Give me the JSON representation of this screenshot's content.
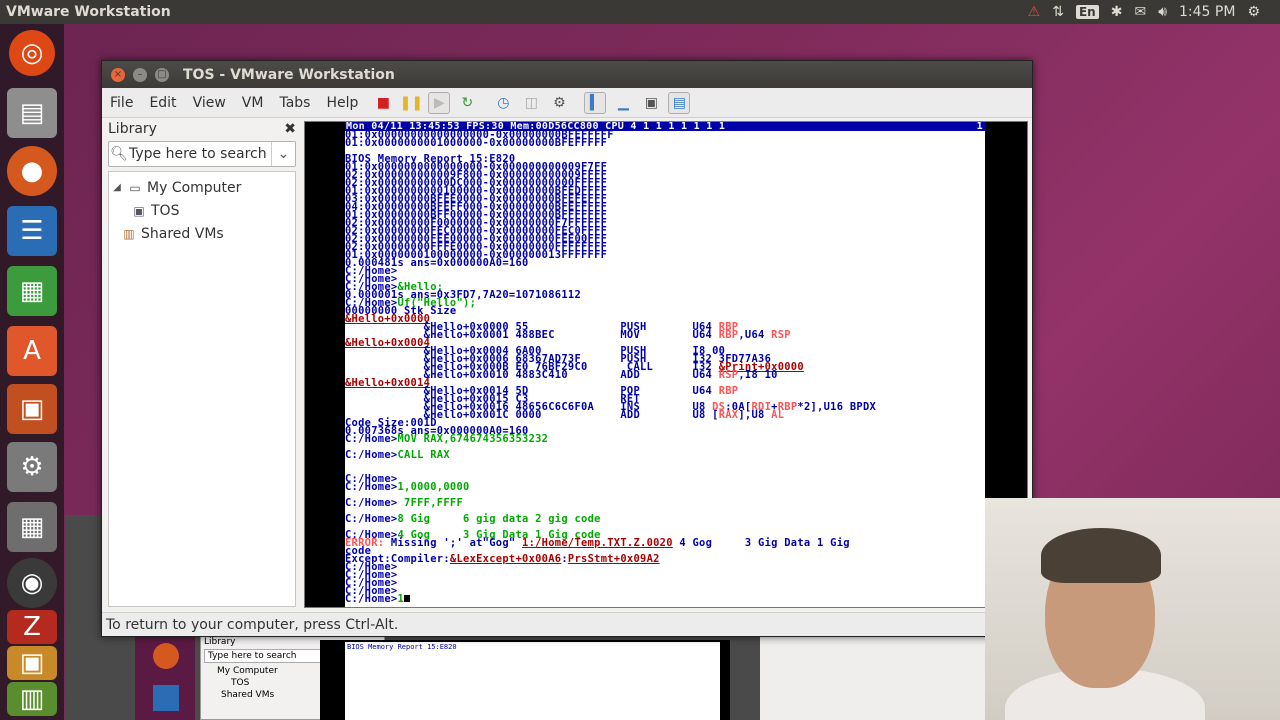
{
  "top_panel": {
    "app_title": "VMware Workstation",
    "language": "En",
    "clock": "1:45 PM"
  },
  "window": {
    "title": "TOS - VMware Workstation",
    "menus": [
      "File",
      "Edit",
      "View",
      "VM",
      "Tabs",
      "Help"
    ]
  },
  "library": {
    "title": "Library",
    "search_placeholder": "Type here to search",
    "tree": {
      "my_computer": "My Computer",
      "tos": "TOS",
      "shared_vms": "Shared VMs"
    }
  },
  "status_bar": {
    "message": "To return to your computer, press Ctrl-Alt."
  },
  "vm_screen": {
    "status_line": "Mon 04/11 13:45:53 FPS:30 Mem:00D56CC800 CPU 4 1 1 1 1 1 1 1",
    "status_tail": "1",
    "lines": [
      [
        {
          "t": "01:0x00000000000000000-0x00000000BFEFFFFF",
          "c": "b"
        }
      ],
      [
        {
          "t": "01:0x0000000001000000-0x00000000BFEFFFFF",
          "c": "b"
        }
      ],
      [
        {
          "t": "",
          "c": "b"
        }
      ],
      [
        {
          "t": "BIOS Memory Report 15:E820",
          "c": "b"
        }
      ],
      [
        {
          "t": "01:0x0000000000000000-0x000000000009F7FF",
          "c": "b"
        }
      ],
      [
        {
          "t": "02:0x000000000009F800-0x000000000009FFFF",
          "c": "b"
        }
      ],
      [
        {
          "t": "02:0x00000000000DC000-0x00000000000FFFFF",
          "c": "b"
        }
      ],
      [
        {
          "t": "01:0x0000000000100000-0x00000000BFEDFFFF",
          "c": "b"
        }
      ],
      [
        {
          "t": "03:0x00000000BFEE0000-0x00000000BFEFEFFF",
          "c": "b"
        }
      ],
      [
        {
          "t": "04:0x00000000BFEFF000-0x00000000BFEFFFFF",
          "c": "b"
        }
      ],
      [
        {
          "t": "01:0x00000000BFF00000-0x00000000BFFFFFFF",
          "c": "b"
        }
      ],
      [
        {
          "t": "02:0x00000000F0000000-0x00000000F7FFFFFF",
          "c": "b"
        }
      ],
      [
        {
          "t": "02:0x00000000FEC00000-0x00000000FEC0FFFF",
          "c": "b"
        }
      ],
      [
        {
          "t": "02:0x00000000FEE00000-0x00000000FEE00FFF",
          "c": "b"
        }
      ],
      [
        {
          "t": "02:0x00000000FFFE0000-0x00000000FFFFFFFF",
          "c": "b"
        }
      ],
      [
        {
          "t": "01:0x0000000100000000-0x000000013FFFFFFF",
          "c": "b"
        }
      ],
      [
        {
          "t": "0.000481s ans=0x000000A0=160",
          "c": "b"
        }
      ],
      [
        {
          "t": "C:/Home>",
          "c": "b"
        }
      ],
      [
        {
          "t": "C:/Home>",
          "c": "b"
        }
      ],
      [
        {
          "t": "C:/Home>",
          "c": "b"
        },
        {
          "t": "&Hello;",
          "c": "g"
        }
      ],
      [
        {
          "t": "0.000001s ans=0x3FD7,7A20=1071086112",
          "c": "b"
        }
      ],
      [
        {
          "t": "C:/Home>",
          "c": "b"
        },
        {
          "t": "Uf(\"Hello\");",
          "c": "g"
        }
      ],
      [
        {
          "t": "00000000 Stk Size",
          "c": "b"
        }
      ],
      [
        {
          "t": "&Hello+0x0000",
          "c": "rl"
        }
      ],
      [
        {
          "t": "            &Hello+0x0000 55              PUSH       U64 ",
          "c": "b"
        },
        {
          "t": "RBP",
          "c": "lr"
        }
      ],
      [
        {
          "t": "            &Hello+0x0001 488BEC          MOV        U64 ",
          "c": "b"
        },
        {
          "t": "RBP",
          "c": "lr"
        },
        {
          "t": ",U64 ",
          "c": "b"
        },
        {
          "t": "RSP",
          "c": "lr"
        }
      ],
      [
        {
          "t": "&Hello+0x0004",
          "c": "rl"
        }
      ],
      [
        {
          "t": "            &Hello+0x0004 6A00            PUSH       I8 00",
          "c": "b"
        }
      ],
      [
        {
          "t": "            &Hello+0x0006 68367AD73F      PUSH       I32 3FD77A36",
          "c": "b"
        }
      ],
      [
        {
          "t": "            &Hello+0x000B E0 76BF29C0      CALL      I32 ",
          "c": "b"
        },
        {
          "t": "&Print+0x0000",
          "c": "rl"
        }
      ],
      [
        {
          "t": "            &Hello+0x0010 4883C410        ADD        U64 ",
          "c": "b"
        },
        {
          "t": "RSP",
          "c": "lr"
        },
        {
          "t": ",I8 10",
          "c": "b"
        }
      ],
      [
        {
          "t": "&Hello+0x0014",
          "c": "rl"
        }
      ],
      [
        {
          "t": "            &Hello+0x0014 5D              POP        U64 ",
          "c": "b"
        },
        {
          "t": "RBP",
          "c": "lr"
        }
      ],
      [
        {
          "t": "            &Hello+0x0015 C3              RET",
          "c": "b"
        }
      ],
      [
        {
          "t": "            &Hello+0x0016 48656C6C6F0A    INS        U8 ",
          "c": "b"
        },
        {
          "t": "DS",
          "c": "lr"
        },
        {
          "t": ":0A[",
          "c": "b"
        },
        {
          "t": "RDI",
          "c": "lr"
        },
        {
          "t": "+",
          "c": "b"
        },
        {
          "t": "RBP",
          "c": "lr"
        },
        {
          "t": "*2],U16 BPDX",
          "c": "b"
        }
      ],
      [
        {
          "t": "            &Hello+0x001C 0000            ADD        U8 [",
          "c": "b"
        },
        {
          "t": "RAX",
          "c": "lr"
        },
        {
          "t": "],U8 ",
          "c": "b"
        },
        {
          "t": "AL",
          "c": "lr"
        }
      ],
      [
        {
          "t": "Code Size:001D",
          "c": "b"
        }
      ],
      [
        {
          "t": "0.007368s ans=0x000000A0=160",
          "c": "b"
        }
      ],
      [
        {
          "t": "C:/Home>",
          "c": "b"
        },
        {
          "t": "MOV RAX,674674356353232",
          "c": "g"
        }
      ],
      [
        {
          "t": "",
          "c": "b"
        }
      ],
      [
        {
          "t": "C:/Home>",
          "c": "b"
        },
        {
          "t": "CALL RAX",
          "c": "g"
        }
      ],
      [
        {
          "t": "",
          "c": "b"
        }
      ],
      [
        {
          "t": "",
          "c": "b"
        }
      ],
      [
        {
          "t": "C:/Home>",
          "c": "b"
        }
      ],
      [
        {
          "t": "C:/Home>",
          "c": "b"
        },
        {
          "t": "1,0000,0000",
          "c": "g"
        }
      ],
      [
        {
          "t": "",
          "c": "b"
        }
      ],
      [
        {
          "t": "C:/Home>",
          "c": "b"
        },
        {
          "t": " 7FFF,FFFF",
          "c": "g"
        }
      ],
      [
        {
          "t": "",
          "c": "b"
        }
      ],
      [
        {
          "t": "C:/Home>",
          "c": "b"
        },
        {
          "t": "8 Gig     6 gig data 2 gig code",
          "c": "g"
        }
      ],
      [
        {
          "t": "",
          "c": "b"
        }
      ],
      [
        {
          "t": "C:/Home>",
          "c": "b"
        },
        {
          "t": "4 Gog     3 Gig Data 1 Gig code",
          "c": "g"
        }
      ],
      [
        {
          "t": "ERROR:",
          "c": "lr"
        },
        {
          "t": " Missing ';' at\"Gog\" ",
          "c": "b"
        },
        {
          "t": "1:/Home/Temp.TXT.Z.0020",
          "c": "rl"
        },
        {
          "t": " 4 Gog     3 Gig Data 1 Gig",
          "c": "b"
        }
      ],
      [
        {
          "t": "code",
          "c": "b"
        }
      ],
      [
        {
          "t": "Except:Compiler:",
          "c": "b"
        },
        {
          "t": "&LexExcept+0x00A6",
          "c": "rl"
        },
        {
          "t": ":",
          "c": "b"
        },
        {
          "t": "PrsStmt+0x09A2",
          "c": "rl"
        }
      ],
      [
        {
          "t": "C:/Home>",
          "c": "b"
        }
      ],
      [
        {
          "t": "C:/Home>",
          "c": "b"
        }
      ],
      [
        {
          "t": "C:/Home>",
          "c": "b"
        }
      ],
      [
        {
          "t": "C:/Home>",
          "c": "b"
        }
      ],
      [
        {
          "t": "C:/Home>",
          "c": "b"
        },
        {
          "t": "1",
          "c": "g"
        }
      ]
    ]
  },
  "background_window": {
    "library_title": "Library",
    "search_placeholder": "Type here to search",
    "my_computer": "My Computer",
    "tos": "TOS",
    "shared_vms": "Shared VMs",
    "screen_title": "BIOS Memory Report 15:E820"
  },
  "colors": {
    "ubuntu_orange": "#e9663a",
    "vm_blue": "#0000a8",
    "vm_green": "#00a800",
    "vm_red": "#a80000"
  }
}
